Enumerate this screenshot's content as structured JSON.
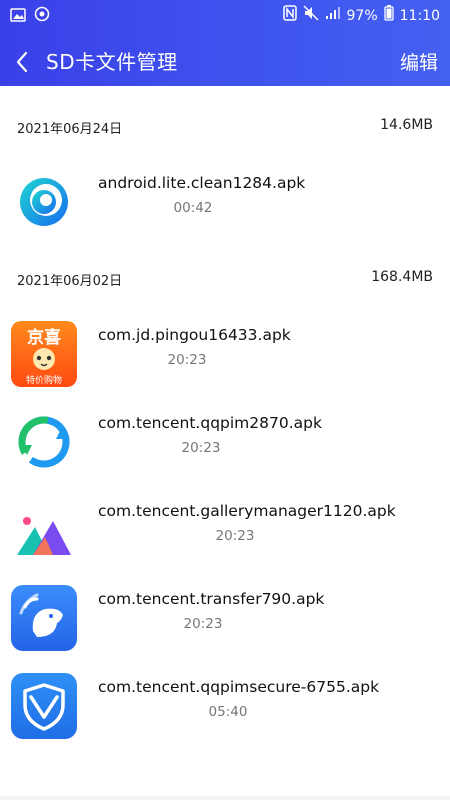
{
  "status_bar": {
    "battery": "97%",
    "time": "11:10",
    "icons": [
      "image-icon",
      "sync-icon",
      "nfc-icon",
      "mute-icon",
      "signal-icon",
      "battery-icon"
    ]
  },
  "header": {
    "title": "SD卡文件管理",
    "edit_label": "编辑",
    "back_icon": "chevron-left-icon"
  },
  "groups": [
    {
      "date": "2021年06月24日",
      "size": "14.6MB",
      "files": [
        {
          "name": "android.lite.clean1284.apk",
          "time": "00:42",
          "icon": "clean-swirl-app-icon"
        }
      ]
    },
    {
      "date": "2021年06月02日",
      "size": "168.4MB",
      "files": [
        {
          "name": "com.jd.pingou16433.apk",
          "time": "20:23",
          "icon": "jingxi-app-icon",
          "icon_text_top": "京喜",
          "icon_text_bottom": "特价购物"
        },
        {
          "name": "com.tencent.qqpim2870.apk",
          "time": "20:23",
          "icon": "qqpim-sync-app-icon"
        },
        {
          "name": "com.tencent.gallerymanager1120.apk",
          "time": "20:23",
          "icon": "gallery-mountains-app-icon"
        },
        {
          "name": "com.tencent.transfer790.apk",
          "time": "20:23",
          "icon": "transfer-bird-app-icon"
        },
        {
          "name": "com.tencent.qqpimsecure-6755.apk",
          "time": "05:40",
          "icon": "security-shield-app-icon"
        }
      ]
    }
  ],
  "colors": {
    "header_gradient_start": "#3a40e8",
    "header_gradient_end": "#4460f0",
    "text_secondary": "#777777"
  }
}
